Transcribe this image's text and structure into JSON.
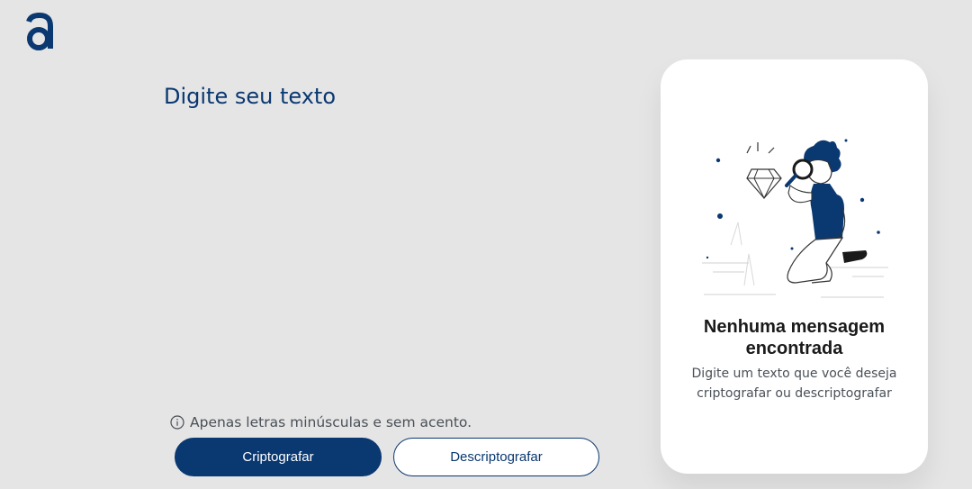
{
  "logo": {
    "icon": "alura-a-logo-icon",
    "color": "#0a3871"
  },
  "input": {
    "placeholder": "Digite seu texto",
    "value": ""
  },
  "hint": {
    "icon": "info-circle-icon",
    "text": "Apenas letras minúsculas e sem acento."
  },
  "buttons": {
    "encrypt_label": "Criptografar",
    "decrypt_label": "Descriptografar"
  },
  "result_panel": {
    "illustration": "person-with-magnifying-glass-and-diamond",
    "title": "Nenhuma mensagem encontrada",
    "subtitle": "Digite um texto que você deseja criptografar ou descriptografar"
  },
  "colors": {
    "background": "#e5e5e5",
    "primary": "#0a3871",
    "panel": "#ffffff",
    "muted_text": "#495057"
  }
}
